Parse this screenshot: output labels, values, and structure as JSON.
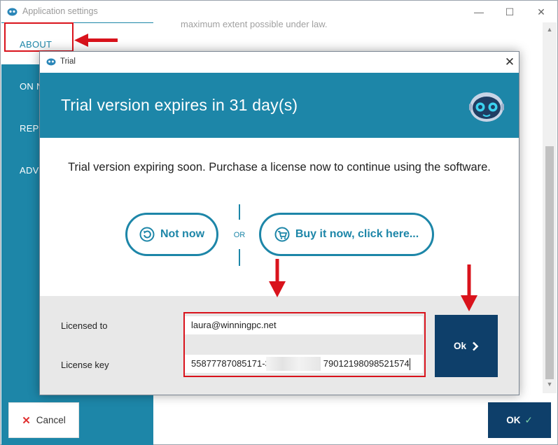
{
  "main_window": {
    "title": "Application settings",
    "window_controls": {
      "minimize": "—",
      "maximize": "☐",
      "close": "✕"
    },
    "content_text": "maximum extent possible under law.",
    "sidebar": {
      "items": [
        {
          "label": "ABOUT",
          "selected": true
        },
        {
          "label": "ON N"
        },
        {
          "label": "REPO"
        },
        {
          "label": "ADV"
        }
      ]
    },
    "cancel_label": "Cancel",
    "cancel_icon": "✕",
    "ok_label": "OK",
    "ok_icon": "✓"
  },
  "dialog": {
    "title": "Trial",
    "close": "✕",
    "heading": "Trial version expires in 31 day(s)",
    "message": "Trial version expiring soon. Purchase a license now to continue using the software.",
    "not_now_label": "Not now",
    "or_label": "OR",
    "buy_label": "Buy it now, click here...",
    "licensed_to_label": "Licensed to",
    "licensed_to_value": "laura@winningpc.net",
    "license_key_label": "License key",
    "license_key_prefix": "55877787085171-3",
    "license_key_suffix": "79012198098521574",
    "ok_label": "Ok",
    "ok_icon": "›"
  },
  "colors": {
    "accent": "#1d86a8",
    "dark_button": "#0e3f6a",
    "annotation_red": "#d9131c"
  }
}
